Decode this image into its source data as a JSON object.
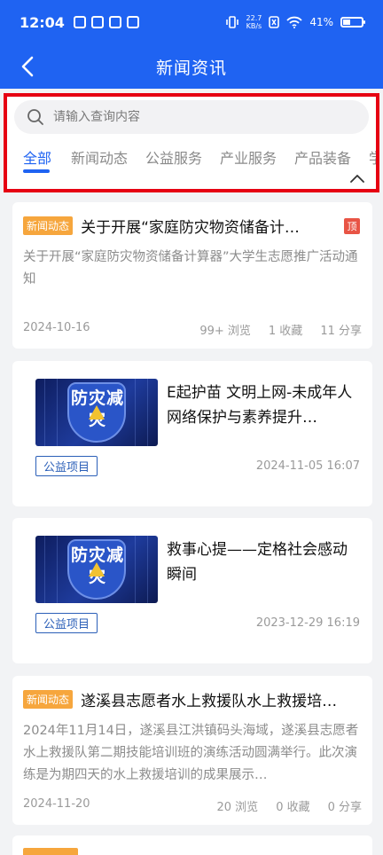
{
  "status_bar": {
    "time": "12:04",
    "net_speed_top": "22.7",
    "net_speed_bottom": "KB/s",
    "battery_text": "41%",
    "battery_level": 0.41
  },
  "header": {
    "title": "新闻资讯"
  },
  "search": {
    "placeholder": "请输入查询内容"
  },
  "tabs": [
    "全部",
    "新闻动态",
    "公益服务",
    "产业服务",
    "产品装备",
    "学"
  ],
  "active_tab": "全部",
  "cards": [
    {
      "badge": "新闻动态",
      "title": "关于开展“家庭防灾物资储备计…",
      "top_badge": "顶",
      "summary": "关于开展“家庭防灾物资储备计算器”大学生志愿推广活动通知",
      "date": "2024-10-16",
      "views": "99+ 浏览",
      "favorites": "1 收藏",
      "shares": "11 分享"
    },
    {
      "thumb_text": "防灾减灾",
      "title": "E起护苗 文明上网-未成年人网络保护与素养提升…",
      "tag": "公益项目",
      "datetime": "2024-11-05 16:07"
    },
    {
      "thumb_text": "防灾减灾",
      "title": "救事心提——定格社会感动瞬间",
      "tag": "公益项目",
      "datetime": "2023-12-29 16:19"
    },
    {
      "badge": "新闻动态",
      "title": "遂溪县志愿者水上救援队水上救援培…",
      "summary": "2024年11月14日，遂溪县江洪镇码头海域，遂溪县志愿者水上救援队第二期技能培训班的演练活动圆满举行。此次演练是为期四天的水上救援培训的成果展示…",
      "date": "2024-11-20",
      "views": "20 浏览",
      "favorites": "0 收藏",
      "shares": "0 分享"
    }
  ],
  "icons": {
    "back": "back-arrow-icon",
    "search": "search-icon",
    "collapse": "chevron-up-icon"
  },
  "colors": {
    "primary": "#1f63f2",
    "news_badge": "#f6a63d",
    "top_badge": "#e85445",
    "highlight_border": "#e60012"
  }
}
